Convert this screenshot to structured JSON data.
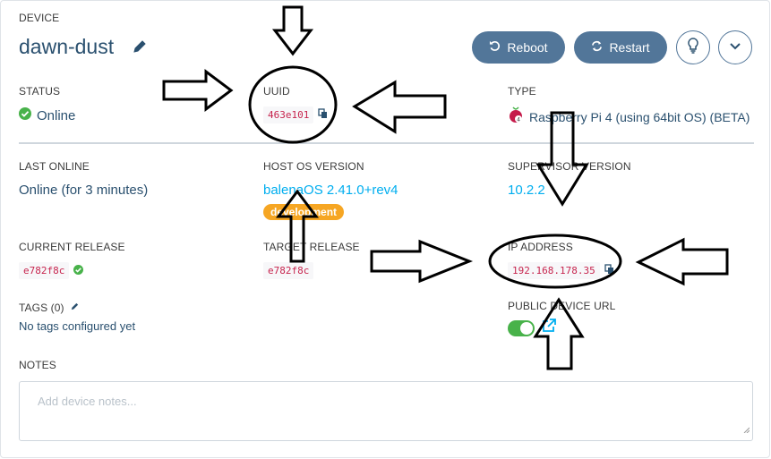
{
  "device": {
    "section_label": "DEVICE",
    "name": "dawn-dust"
  },
  "actions": {
    "reboot_label": "Reboot",
    "restart_label": "Restart"
  },
  "status": {
    "label": "STATUS",
    "value": "Online"
  },
  "uuid": {
    "label": "UUID",
    "value": "463e101"
  },
  "type": {
    "label": "TYPE",
    "value": "Raspberry Pi 4 (using 64bit OS) (BETA)"
  },
  "last_online": {
    "label": "LAST ONLINE",
    "value": "Online (for 3 minutes)"
  },
  "host_os": {
    "label": "HOST OS VERSION",
    "value": "balenaOS 2.41.0+rev4",
    "badge": "development"
  },
  "supervisor": {
    "label": "SUPERVISOR VERSION",
    "value": "10.2.2"
  },
  "current_release": {
    "label": "CURRENT RELEASE",
    "value": "e782f8c"
  },
  "target_release": {
    "label": "TARGET RELEASE",
    "value": "e782f8c"
  },
  "ip_address": {
    "label": "IP ADDRESS",
    "value": "192.168.178.35"
  },
  "tags": {
    "label": "TAGS (0)",
    "empty_text": "No tags configured yet"
  },
  "public_url": {
    "label": "PUBLIC DEVICE URL",
    "enabled": true
  },
  "notes": {
    "label": "NOTES",
    "placeholder": "Add device notes..."
  },
  "colors": {
    "primary": "#2a506f",
    "button": "#527699",
    "link": "#00aeef",
    "success": "#48b24a",
    "code": "#c7254e",
    "badge": "#f6a623"
  }
}
